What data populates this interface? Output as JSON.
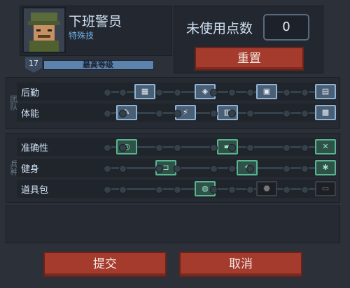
{
  "profile": {
    "name": "下班警员",
    "subtitle": "特殊技",
    "level": "17",
    "level_text": "最高等级"
  },
  "points": {
    "label": "未使用点数",
    "value": "0",
    "reset_label": "重置"
  },
  "groups": [
    {
      "title": "团队",
      "rows": [
        {
          "label": "后勤",
          "nodes": [
            "▦",
            "◈",
            "▣",
            "▤"
          ]
        },
        {
          "label": "体能",
          "nodes": [
            "✎",
            "⚡",
            "▥",
            "▩"
          ]
        }
      ]
    },
    {
      "title": "兵种",
      "rows": [
        {
          "label": "准确性",
          "nodes": [
            "◎",
            "▬",
            "✕"
          ]
        },
        {
          "label": "健身",
          "nodes": [
            "⊐",
            "✦",
            "✱"
          ]
        },
        {
          "label": "道具包",
          "nodes": [
            "◍",
            "⬣",
            "▭"
          ]
        }
      ]
    }
  ],
  "actions": {
    "submit_label": "提交",
    "cancel_label": "取消"
  }
}
